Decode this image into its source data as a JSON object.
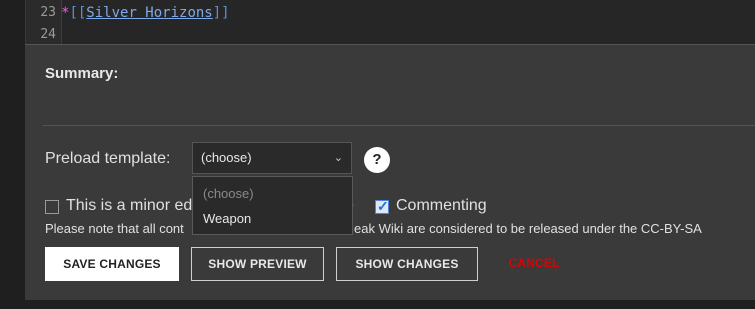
{
  "editor": {
    "lines": [
      {
        "number": "23",
        "bullet": "*",
        "open": "[[",
        "link": "Silver Horizons",
        "close": "]]"
      },
      {
        "number": "24",
        "text": ""
      }
    ]
  },
  "summary": {
    "label": "Summary:"
  },
  "preload": {
    "label": "Preload template:",
    "selected": "(choose)",
    "options": [
      "(choose)",
      "Weapon"
    ],
    "help": "?"
  },
  "options": {
    "minor_edit": {
      "label": "This is a minor ed",
      "label_tail": "e",
      "checked": false
    },
    "commenting": {
      "label": "Commenting",
      "checked": true
    }
  },
  "note": {
    "text_a": "Please note that all cont",
    "text_b": "eak Wiki are considered to be released under the CC-BY-SA"
  },
  "buttons": {
    "save": "SAVE CHANGES",
    "preview": "SHOW PREVIEW",
    "diff": "SHOW CHANGES",
    "cancel": "CANCEL"
  },
  "colors": {
    "cancel": "#e00000",
    "checkbox_accent": "#4d86d9",
    "panel_bg": "#3a3a3a"
  }
}
